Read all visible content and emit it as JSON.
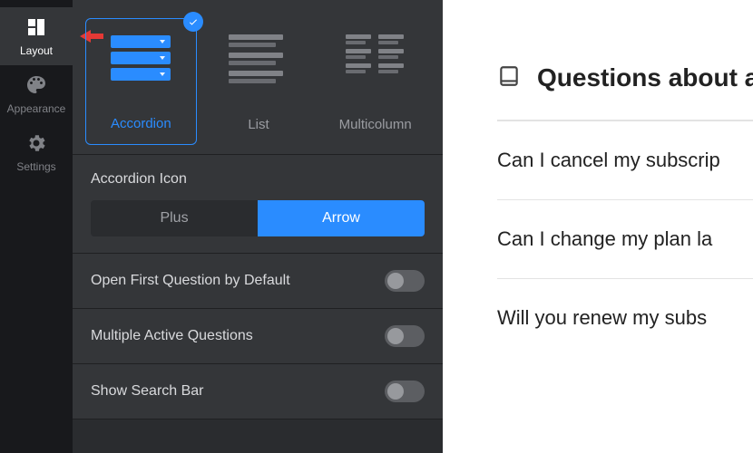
{
  "sidebar": {
    "items": [
      {
        "label": "Layout",
        "active": true
      },
      {
        "label": "Appearance",
        "active": false
      },
      {
        "label": "Settings",
        "active": false
      }
    ]
  },
  "layouts": {
    "options": [
      {
        "label": "Accordion",
        "selected": true
      },
      {
        "label": "List",
        "selected": false
      },
      {
        "label": "Multicolumn",
        "selected": false
      }
    ]
  },
  "accordion_icon": {
    "title": "Accordion Icon",
    "options": [
      {
        "label": "Plus",
        "active": false
      },
      {
        "label": "Arrow",
        "active": true
      }
    ]
  },
  "toggles": [
    {
      "label": "Open First Question by Default",
      "on": false
    },
    {
      "label": "Multiple Active Questions",
      "on": false
    },
    {
      "label": "Show Search Bar",
      "on": false
    }
  ],
  "preview": {
    "heading": "Questions about al",
    "questions": [
      "Can I cancel my subscrip",
      "Can I change my plan la",
      "Will you renew my subs"
    ]
  }
}
